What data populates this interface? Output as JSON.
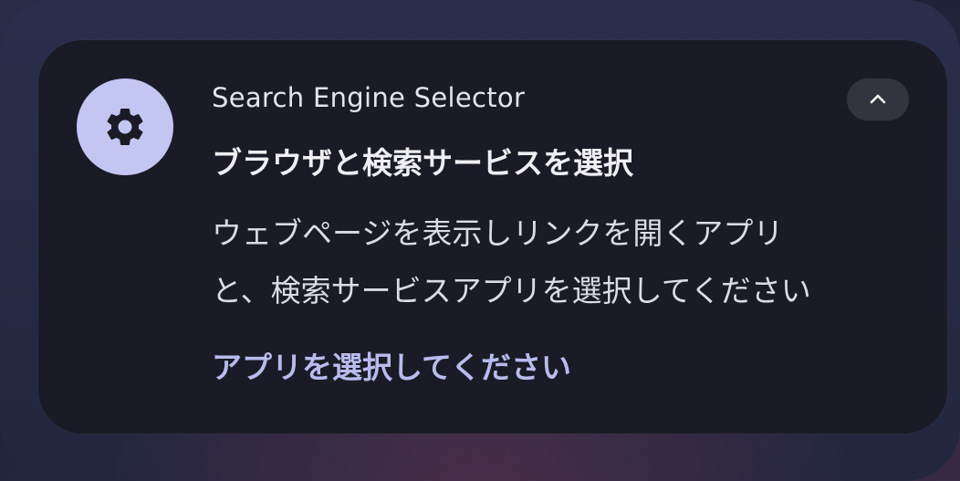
{
  "notification": {
    "app_name": "Search Engine Selector",
    "app_icon": "gear-icon",
    "title": "ブラウザと検索サービスを選択",
    "body_line_1": "ウェブページを表示しリンクを開くアプリ",
    "body_line_2": "と、検索サービスアプリを選択してください",
    "action_label": "アプリを選択してください",
    "expand_icon": "chevron-up-icon",
    "colors": {
      "icon_background": "#c4c6f2",
      "card_background": "#1a1b26",
      "action_text": "#b9bbec"
    }
  }
}
